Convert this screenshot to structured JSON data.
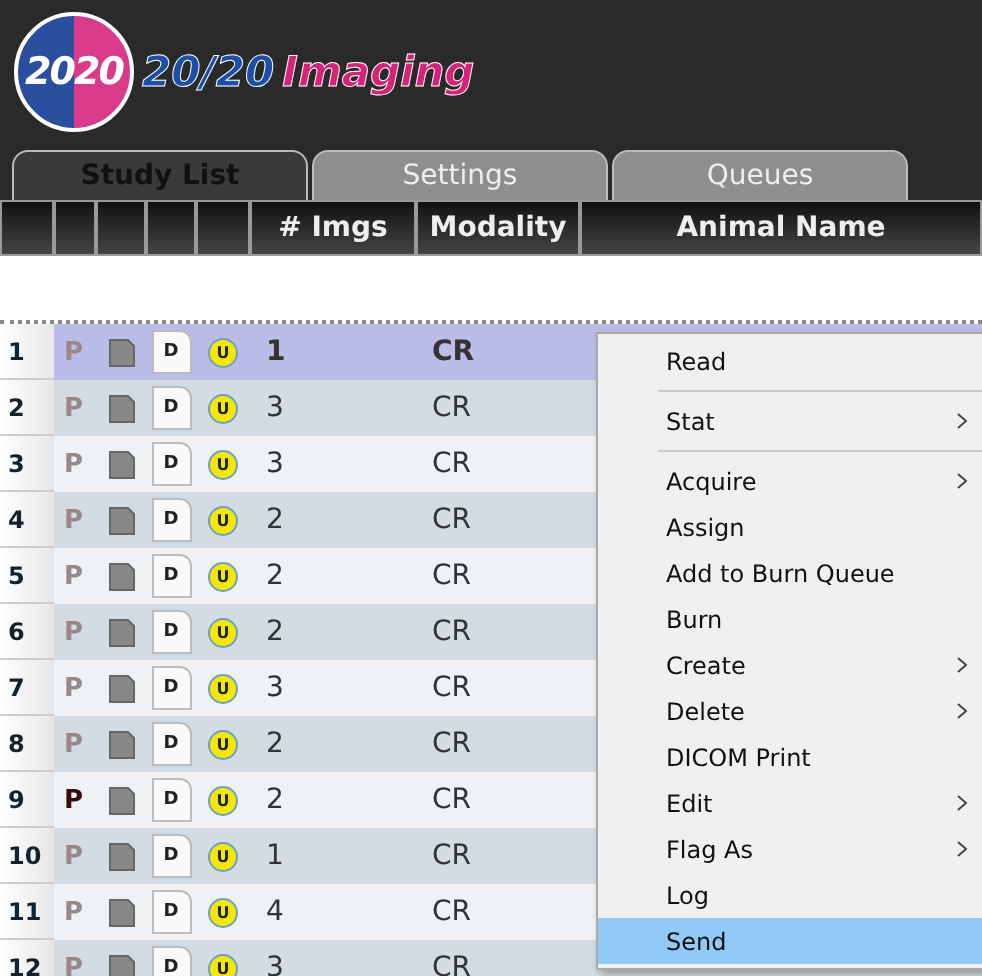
{
  "logo": {
    "badge": [
      "20",
      "20"
    ],
    "brand": "20/20",
    "product": "Imaging"
  },
  "tabs": [
    {
      "label": "Study List",
      "selected": true
    },
    {
      "label": "Settings",
      "selected": false
    },
    {
      "label": "Queues",
      "selected": false
    }
  ],
  "table": {
    "columns": [
      "",
      "",
      "",
      "",
      "# Imgs",
      "Modality",
      "Animal Name"
    ],
    "rows": [
      {
        "num": "1",
        "p": "P",
        "p_active": false,
        "d": "D",
        "u": "U",
        "imgs": "1",
        "modality": "CR",
        "selected": true
      },
      {
        "num": "2",
        "p": "P",
        "p_active": false,
        "d": "D",
        "u": "U",
        "imgs": "3",
        "modality": "CR",
        "selected": false
      },
      {
        "num": "3",
        "p": "P",
        "p_active": false,
        "d": "D",
        "u": "U",
        "imgs": "3",
        "modality": "CR",
        "selected": false
      },
      {
        "num": "4",
        "p": "P",
        "p_active": false,
        "d": "D",
        "u": "U",
        "imgs": "2",
        "modality": "CR",
        "selected": false
      },
      {
        "num": "5",
        "p": "P",
        "p_active": false,
        "d": "D",
        "u": "U",
        "imgs": "2",
        "modality": "CR",
        "selected": false
      },
      {
        "num": "6",
        "p": "P",
        "p_active": false,
        "d": "D",
        "u": "U",
        "imgs": "2",
        "modality": "CR",
        "selected": false
      },
      {
        "num": "7",
        "p": "P",
        "p_active": false,
        "d": "D",
        "u": "U",
        "imgs": "3",
        "modality": "CR",
        "selected": false
      },
      {
        "num": "8",
        "p": "P",
        "p_active": false,
        "d": "D",
        "u": "U",
        "imgs": "2",
        "modality": "CR",
        "selected": false
      },
      {
        "num": "9",
        "p": "P",
        "p_active": true,
        "d": "D",
        "u": "U",
        "imgs": "2",
        "modality": "CR",
        "selected": false
      },
      {
        "num": "10",
        "p": "P",
        "p_active": false,
        "d": "D",
        "u": "U",
        "imgs": "1",
        "modality": "CR",
        "selected": false
      },
      {
        "num": "11",
        "p": "P",
        "p_active": false,
        "d": "D",
        "u": "U",
        "imgs": "4",
        "modality": "CR",
        "selected": false
      },
      {
        "num": "12",
        "p": "P",
        "p_active": false,
        "d": "D",
        "u": "U",
        "imgs": "3",
        "modality": "CR",
        "selected": false
      }
    ]
  },
  "context_menu": [
    {
      "label": "Read",
      "submenu": false,
      "separator_after": true,
      "selected": false
    },
    {
      "label": "Stat",
      "submenu": true,
      "separator_after": true,
      "selected": false
    },
    {
      "label": "Acquire",
      "submenu": true,
      "separator_after": false,
      "selected": false
    },
    {
      "label": "Assign",
      "submenu": false,
      "separator_after": false,
      "selected": false
    },
    {
      "label": "Add to Burn Queue",
      "submenu": false,
      "separator_after": false,
      "selected": false
    },
    {
      "label": "Burn",
      "submenu": false,
      "separator_after": false,
      "selected": false
    },
    {
      "label": "Create",
      "submenu": true,
      "separator_after": false,
      "selected": false
    },
    {
      "label": "Delete",
      "submenu": true,
      "separator_after": false,
      "selected": false
    },
    {
      "label": "DICOM Print",
      "submenu": false,
      "separator_after": false,
      "selected": false
    },
    {
      "label": "Edit",
      "submenu": true,
      "separator_after": false,
      "selected": false
    },
    {
      "label": "Flag As",
      "submenu": true,
      "separator_after": false,
      "selected": false
    },
    {
      "label": "Log",
      "submenu": false,
      "separator_after": false,
      "selected": false
    },
    {
      "label": "Send",
      "submenu": false,
      "separator_after": false,
      "selected": true
    }
  ]
}
